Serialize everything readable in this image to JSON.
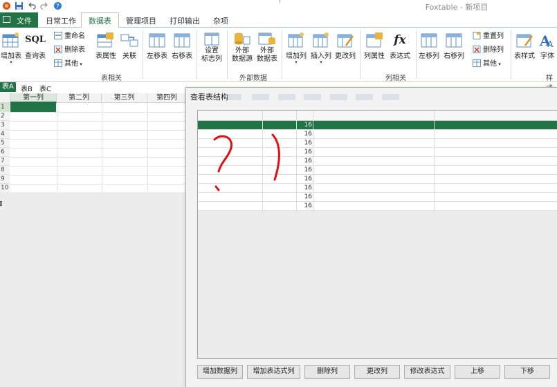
{
  "app": {
    "title": "Foxtable - 新项目"
  },
  "menu": {
    "file_label": "文件",
    "tabs": [
      "日常工作",
      "数据表",
      "管理项目",
      "打印输出",
      "杂项"
    ],
    "active_tab": "数据表"
  },
  "ribbon": {
    "buttons": {
      "add_table": "增加表",
      "query_table": "查询表",
      "sql_icon_text": "SQL",
      "rename": "重命名",
      "delete_table": "删除表",
      "other1": "其他",
      "table_props": "表属性",
      "relation": "关联",
      "move_left_table": "左移表",
      "move_right_table": "右移表",
      "set_flag_col_line1": "设置",
      "set_flag_col_line2": "标志列",
      "ext_source_line1": "外部",
      "ext_source_line2": "数据源",
      "ext_table_line1": "外部",
      "ext_table_line2": "数据表",
      "add_col": "增加列",
      "insert_col": "插入列",
      "modify_col": "更改列",
      "col_props": "列属性",
      "expression": "表达式",
      "fx_icon_text": "fx",
      "move_left_col": "左移列",
      "move_right_col": "右移列",
      "reset_col": "重置列",
      "delete_col": "删除列",
      "other2": "其他",
      "table_style": "表样式",
      "font": "字体"
    },
    "groups": {
      "table_related": "表相关",
      "external_data": "外部数据",
      "column_related": "列相关",
      "style_partial": "样式"
    }
  },
  "sheets": {
    "tabs": [
      "表A",
      "表B",
      "表C"
    ],
    "active": "表A"
  },
  "grid": {
    "columns": [
      "第一列",
      "第二列",
      "第三列",
      "第四列"
    ],
    "rows": [
      "1",
      "2",
      "3",
      "4",
      "5",
      "6",
      "7",
      "8",
      "9",
      "10"
    ]
  },
  "dialog": {
    "title": "查看表结构",
    "rows": [
      {
        "length": "16"
      },
      {
        "length": "16"
      },
      {
        "length": "16"
      },
      {
        "length": "16"
      },
      {
        "length": "16"
      },
      {
        "length": "16"
      },
      {
        "length": "16"
      },
      {
        "length": "16"
      },
      {
        "length": "16"
      },
      {
        "length": "16"
      }
    ],
    "buttons": [
      "增加数据列",
      "增加表达式列",
      "删除列",
      "更改列",
      "修改表达式",
      "上移",
      "下移"
    ],
    "annotation_color": "#e01010"
  },
  "colors": {
    "accent": "#217346"
  }
}
